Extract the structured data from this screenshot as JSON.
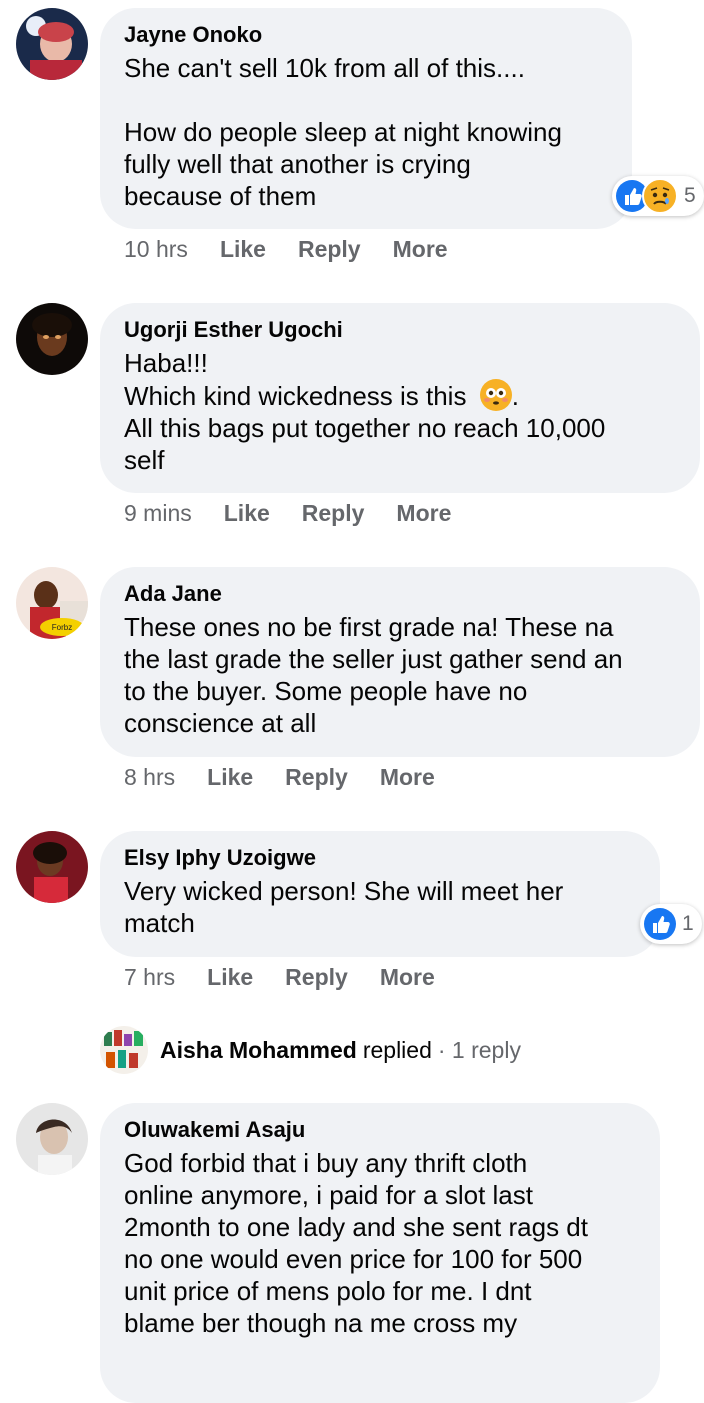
{
  "comments": [
    {
      "author": "Jayne Onoko",
      "text": "She can't sell 10k from all of this....\n\nHow do people sleep at night knowing\nfully well that another is crying\nbecause of them",
      "time": "10 hrs",
      "like": "Like",
      "reply": "Reply",
      "more": "More",
      "reaction_count": "5"
    },
    {
      "author": "Ugorji Esther Ugochi",
      "text_before_emoji": "Haba!!!\nWhich kind wickedness is this ",
      "text_after_emoji": ".\nAll this bags put together no reach 10,000\nself",
      "time": "9 mins",
      "like": "Like",
      "reply": "Reply",
      "more": "More"
    },
    {
      "author": "Ada Jane",
      "text": "These ones no be first grade na! These na\nthe last grade the seller just gather send an\nto the buyer. Some people have no\nconscience at all",
      "time": "8 hrs",
      "like": "Like",
      "reply": "Reply",
      "more": "More"
    },
    {
      "author": "Elsy Iphy Uzoigwe",
      "text": "Very wicked person! She will meet her\nmatch",
      "time": "7 hrs",
      "like": "Like",
      "reply": "Reply",
      "more": "More",
      "reaction_count": "1"
    },
    {
      "author": "Oluwakemi Asaju",
      "text": "God forbid that i buy any thrift cloth\nonline anymore, i paid for a slot last\n2month to one lady and she sent rags dt\nno one would even price for 100 for 500\nunit price of mens polo for me. I dnt\nblame ber though na me cross my"
    }
  ],
  "replied": {
    "name": "Aisha Mohammed",
    "replied": "replied",
    "count": "· 1 reply"
  },
  "colors": {
    "bubble": "#f0f2f5",
    "meta": "#65676b",
    "like_blue": "#1877f2",
    "emoji_yellow": "#f7b125"
  }
}
